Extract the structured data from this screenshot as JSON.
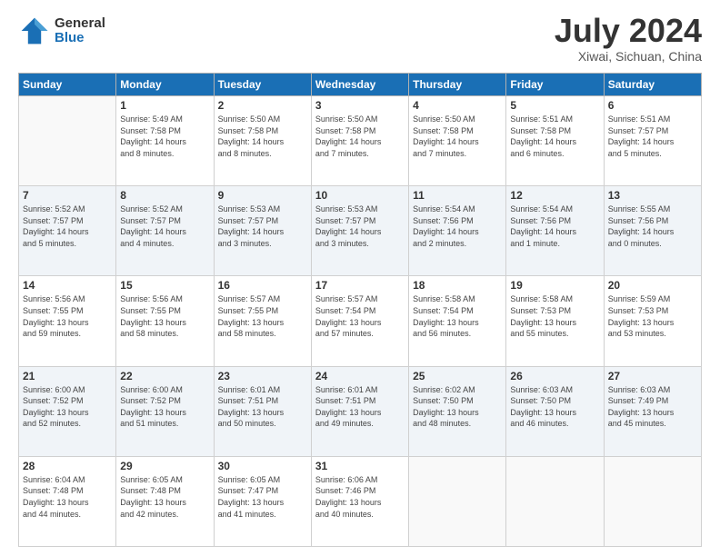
{
  "logo": {
    "general": "General",
    "blue": "Blue"
  },
  "title": "July 2024",
  "location": "Xiwai, Sichuan, China",
  "days_of_week": [
    "Sunday",
    "Monday",
    "Tuesday",
    "Wednesday",
    "Thursday",
    "Friday",
    "Saturday"
  ],
  "weeks": [
    [
      {
        "day": "",
        "info": ""
      },
      {
        "day": "1",
        "info": "Sunrise: 5:49 AM\nSunset: 7:58 PM\nDaylight: 14 hours\nand 8 minutes."
      },
      {
        "day": "2",
        "info": "Sunrise: 5:50 AM\nSunset: 7:58 PM\nDaylight: 14 hours\nand 8 minutes."
      },
      {
        "day": "3",
        "info": "Sunrise: 5:50 AM\nSunset: 7:58 PM\nDaylight: 14 hours\nand 7 minutes."
      },
      {
        "day": "4",
        "info": "Sunrise: 5:50 AM\nSunset: 7:58 PM\nDaylight: 14 hours\nand 7 minutes."
      },
      {
        "day": "5",
        "info": "Sunrise: 5:51 AM\nSunset: 7:58 PM\nDaylight: 14 hours\nand 6 minutes."
      },
      {
        "day": "6",
        "info": "Sunrise: 5:51 AM\nSunset: 7:57 PM\nDaylight: 14 hours\nand 5 minutes."
      }
    ],
    [
      {
        "day": "7",
        "info": "Sunrise: 5:52 AM\nSunset: 7:57 PM\nDaylight: 14 hours\nand 5 minutes."
      },
      {
        "day": "8",
        "info": "Sunrise: 5:52 AM\nSunset: 7:57 PM\nDaylight: 14 hours\nand 4 minutes."
      },
      {
        "day": "9",
        "info": "Sunrise: 5:53 AM\nSunset: 7:57 PM\nDaylight: 14 hours\nand 3 minutes."
      },
      {
        "day": "10",
        "info": "Sunrise: 5:53 AM\nSunset: 7:57 PM\nDaylight: 14 hours\nand 3 minutes."
      },
      {
        "day": "11",
        "info": "Sunrise: 5:54 AM\nSunset: 7:56 PM\nDaylight: 14 hours\nand 2 minutes."
      },
      {
        "day": "12",
        "info": "Sunrise: 5:54 AM\nSunset: 7:56 PM\nDaylight: 14 hours\nand 1 minute."
      },
      {
        "day": "13",
        "info": "Sunrise: 5:55 AM\nSunset: 7:56 PM\nDaylight: 14 hours\nand 0 minutes."
      }
    ],
    [
      {
        "day": "14",
        "info": "Sunrise: 5:56 AM\nSunset: 7:55 PM\nDaylight: 13 hours\nand 59 minutes."
      },
      {
        "day": "15",
        "info": "Sunrise: 5:56 AM\nSunset: 7:55 PM\nDaylight: 13 hours\nand 58 minutes."
      },
      {
        "day": "16",
        "info": "Sunrise: 5:57 AM\nSunset: 7:55 PM\nDaylight: 13 hours\nand 58 minutes."
      },
      {
        "day": "17",
        "info": "Sunrise: 5:57 AM\nSunset: 7:54 PM\nDaylight: 13 hours\nand 57 minutes."
      },
      {
        "day": "18",
        "info": "Sunrise: 5:58 AM\nSunset: 7:54 PM\nDaylight: 13 hours\nand 56 minutes."
      },
      {
        "day": "19",
        "info": "Sunrise: 5:58 AM\nSunset: 7:53 PM\nDaylight: 13 hours\nand 55 minutes."
      },
      {
        "day": "20",
        "info": "Sunrise: 5:59 AM\nSunset: 7:53 PM\nDaylight: 13 hours\nand 53 minutes."
      }
    ],
    [
      {
        "day": "21",
        "info": "Sunrise: 6:00 AM\nSunset: 7:52 PM\nDaylight: 13 hours\nand 52 minutes."
      },
      {
        "day": "22",
        "info": "Sunrise: 6:00 AM\nSunset: 7:52 PM\nDaylight: 13 hours\nand 51 minutes."
      },
      {
        "day": "23",
        "info": "Sunrise: 6:01 AM\nSunset: 7:51 PM\nDaylight: 13 hours\nand 50 minutes."
      },
      {
        "day": "24",
        "info": "Sunrise: 6:01 AM\nSunset: 7:51 PM\nDaylight: 13 hours\nand 49 minutes."
      },
      {
        "day": "25",
        "info": "Sunrise: 6:02 AM\nSunset: 7:50 PM\nDaylight: 13 hours\nand 48 minutes."
      },
      {
        "day": "26",
        "info": "Sunrise: 6:03 AM\nSunset: 7:50 PM\nDaylight: 13 hours\nand 46 minutes."
      },
      {
        "day": "27",
        "info": "Sunrise: 6:03 AM\nSunset: 7:49 PM\nDaylight: 13 hours\nand 45 minutes."
      }
    ],
    [
      {
        "day": "28",
        "info": "Sunrise: 6:04 AM\nSunset: 7:48 PM\nDaylight: 13 hours\nand 44 minutes."
      },
      {
        "day": "29",
        "info": "Sunrise: 6:05 AM\nSunset: 7:48 PM\nDaylight: 13 hours\nand 42 minutes."
      },
      {
        "day": "30",
        "info": "Sunrise: 6:05 AM\nSunset: 7:47 PM\nDaylight: 13 hours\nand 41 minutes."
      },
      {
        "day": "31",
        "info": "Sunrise: 6:06 AM\nSunset: 7:46 PM\nDaylight: 13 hours\nand 40 minutes."
      },
      {
        "day": "",
        "info": ""
      },
      {
        "day": "",
        "info": ""
      },
      {
        "day": "",
        "info": ""
      }
    ]
  ]
}
